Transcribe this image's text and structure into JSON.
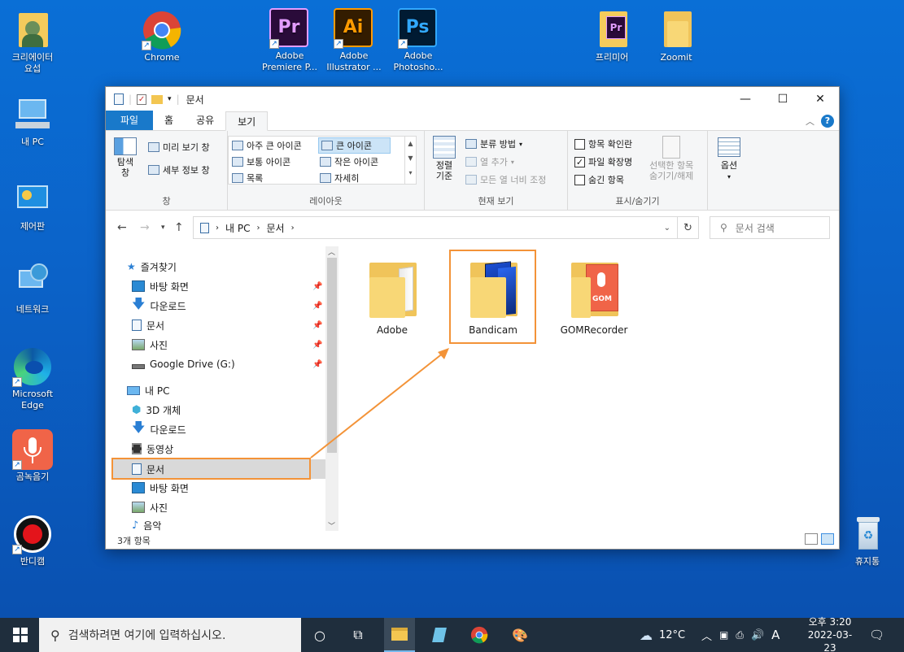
{
  "desktop": {
    "icons": [
      {
        "label": "크리에이터\n요섭"
      },
      {
        "label": "Chrome"
      },
      {
        "label": "Adobe\nPremiere P..."
      },
      {
        "label": "Adobe\nIllustrator ..."
      },
      {
        "label": "Adobe\nPhotosho..."
      },
      {
        "label": "프리미어"
      },
      {
        "label": "Zoomit"
      },
      {
        "label": "내 PC"
      },
      {
        "label": "제어판"
      },
      {
        "label": "네트워크"
      },
      {
        "label": "Microsoft\nEdge"
      },
      {
        "label": "곰녹음기"
      },
      {
        "label": "반디캠"
      },
      {
        "label": "휴지통"
      }
    ],
    "adobe_marks": {
      "pr": "Pr",
      "ai": "Ai",
      "ps": "Ps"
    }
  },
  "window": {
    "title": "문서",
    "tabs": [
      "파일",
      "홈",
      "공유",
      "보기"
    ],
    "ribbon": {
      "pane_group": {
        "name": "창",
        "nav_pane": "탐색\n창",
        "preview": "미리 보기 창",
        "details": "세부 정보 창"
      },
      "layout_group": {
        "name": "레이아웃",
        "items": [
          "아주 큰 아이콘",
          "큰 아이콘",
          "보통 아이콘",
          "작은 아이콘",
          "목록",
          "자세히"
        ]
      },
      "view_group": {
        "name": "현재 보기",
        "sort": "정렬\n기준",
        "group_by": "분류 방법",
        "add_column": "열 추가",
        "fit_columns": "모든 열 너비 조정"
      },
      "show_group": {
        "name": "표시/숨기기",
        "checkbox_items": "항목 확인란",
        "extensions": "파일 확장명",
        "hidden": "숨긴 항목",
        "hide_selected": "선택한 항목\n숨기기/해제"
      },
      "options": "옵션"
    },
    "address": {
      "path": [
        "내 PC",
        "문서"
      ],
      "search_placeholder": "문서 검색"
    },
    "nav": {
      "quick_access": "즐겨찾기",
      "quick_items": [
        "바탕 화면",
        "다운로드",
        "문서",
        "사진",
        "Google Drive (G:)"
      ],
      "this_pc": "내 PC",
      "pc_items": [
        "3D 개체",
        "다운로드",
        "동영상",
        "문서",
        "바탕 화면",
        "사진",
        "음악"
      ]
    },
    "files": [
      "Adobe",
      "Bandicam",
      "GOMRecorder"
    ],
    "gom_logo": "GOM",
    "status": "3개 항목"
  },
  "taskbar": {
    "search_placeholder": "검색하려면 여기에 입력하십시오.",
    "weather": "12°C",
    "ime": "A",
    "time": "오후 3:20",
    "date": "2022-03-23"
  },
  "colors": {
    "accent": "#1979ca",
    "highlight": "#f39338",
    "folder": "#f8d776"
  }
}
